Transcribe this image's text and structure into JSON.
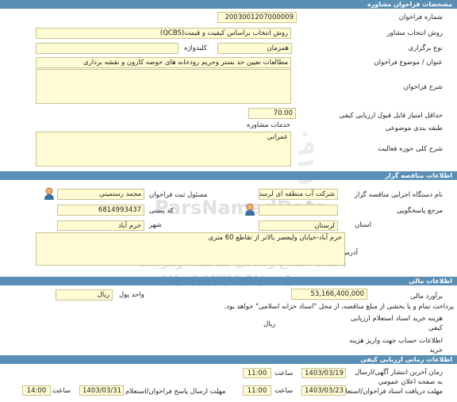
{
  "sections": {
    "consulting": "مشخصات فراخوان مشاوره",
    "tender_org": "اطلاعات مناقصه گزار",
    "financial": "اطلاعات مالی",
    "timing": "اطلاعات زمانی ارزیابی کیفی"
  },
  "consulting": {
    "call_number_label": "شماره فراخوان",
    "call_number": "2003001207000009",
    "method_label": "روش انتخاب مشاور",
    "method": "روش انتخاب براساس کیفیت و قیمت(QCBS)",
    "type_label": "نوع برگزاری",
    "type": "همزمان",
    "keyword_label": "کلیدواژه",
    "keyword": "",
    "subject_label": "عنوان / موضوع فراخوان",
    "subject": "مطالعات تعیین حد بستر وحریم رودخانه های حوضه کارون و نقشه برداری",
    "description_label": "شرح فراخوان",
    "min_score_label": "حداقل امتیاز قابل قبول ارزیابی کیفی",
    "min_score": "70.00",
    "category_label": "طبقه بندی موضوعی",
    "category": "خدمات مشاوره",
    "scope_label": "شرح کلی حوزه فعالیت",
    "scope": "عمرانی"
  },
  "org": {
    "name_label": "نام دستگاه اجرایی مناقصه گزار",
    "name": "شرکت آب منطقه ای لرستان",
    "official_label": "مسئول ثبت فراخوان",
    "official": "محمد رستمینی",
    "ref_label": "مرجع پاسخگویی",
    "ref": "",
    "postal_label": "کد پستی",
    "postal": "6814993437",
    "province_label": "استان",
    "province": "لرستان",
    "city_label": "شهر",
    "city": "خرم آباد",
    "address_label": "آدرس",
    "address": "خرم آباد-خیابان ولیعصر بالاتر از تقاطع 60 متری"
  },
  "finance": {
    "estimate_label": "برآورد مالی",
    "estimate": "53,166,400,000",
    "currency_label": "واحد پول",
    "currency": "ریال",
    "payment_note": "پرداخت تمام و یا بخشی از مبلغ مناقصه، از محل \"اسناد خزانه اسلامی\" خواهد بود.",
    "inquiry_fee_label": "هزینه خرید اسناد استعلام ارزیابی کیفی",
    "inquiry_fee_unit": "ریال",
    "account_label": "اطلاعات حساب جهت واریز هزینه خرید"
  },
  "timing": {
    "publish_label": "زمان آخرین انتشار آگهی/ارسال به صفحه اعلان عمومی",
    "publish_date": "1403/03/19",
    "publish_time_label": "ساعت",
    "publish_time": "11:00",
    "receive_label": "مهلت دریافت اسناد فراخوان/استعلام",
    "receive_date": "1403/03/23",
    "receive_time_label": "ساعت",
    "receive_time": "11:00",
    "send_label": "مهلت ارسال پاسخ فراخوان/استعلام",
    "send_date": "1403/03/31",
    "send_time_label": "ساعت",
    "send_time": "14:00"
  },
  "watermark": {
    "line1": "ParsNamadData",
    "line2": "پایگاه اطلاع رسانی مناقصه ومزایده",
    "line3": "۰۲۱-۸۸۳۴۹۶۷۰-۵",
    "line4": "۰۹۱۵۱۹"
  }
}
